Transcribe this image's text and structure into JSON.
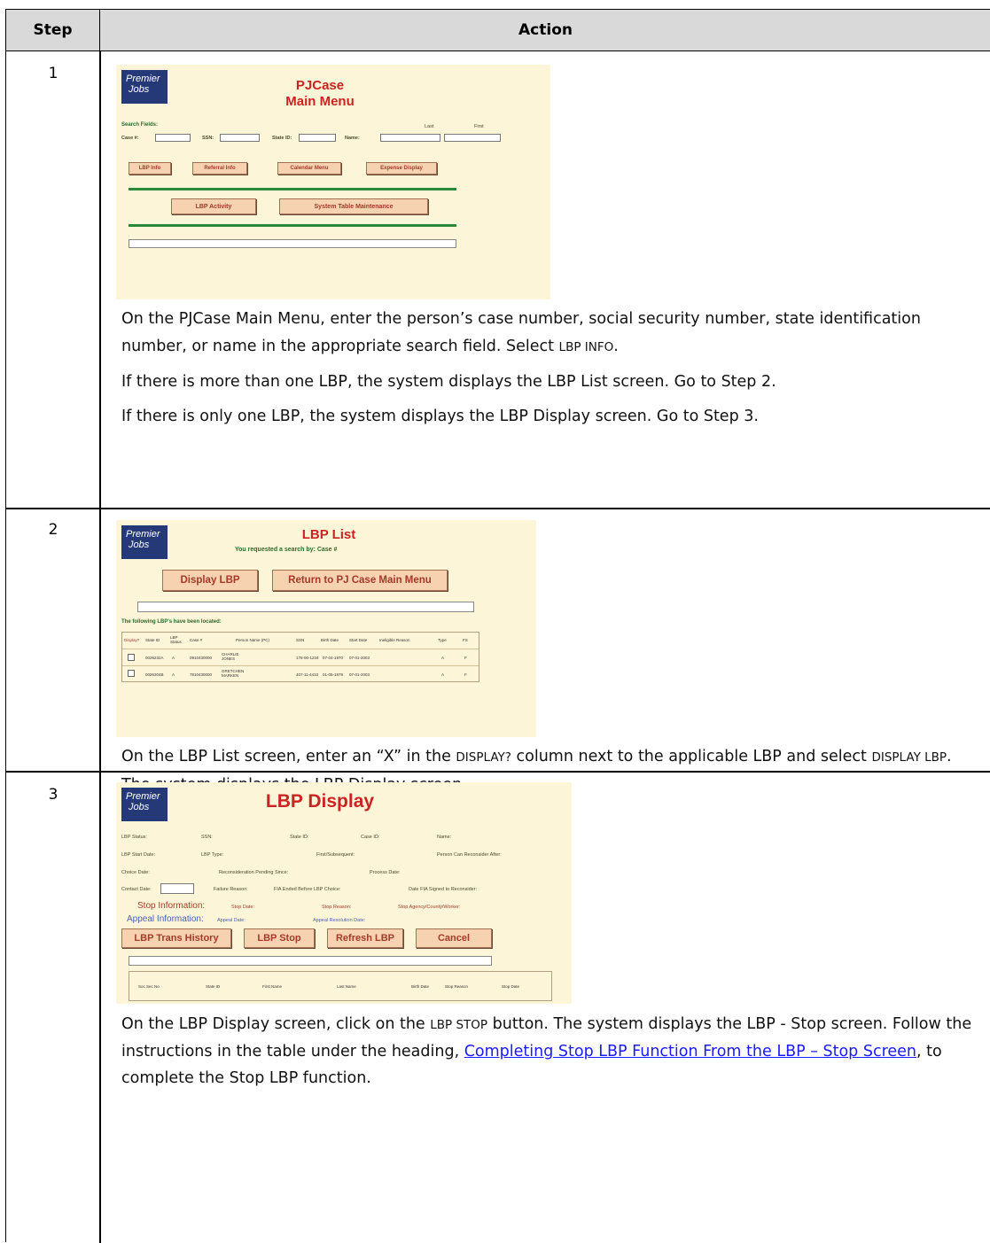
{
  "table": {
    "header": {
      "step": "Step",
      "action": "Action"
    },
    "rows": [
      {
        "step": "1",
        "screenshot": {
          "logo_line1": "Premier",
          "logo_line2": "Jobs",
          "title_line1": "PJCase",
          "title_line2": "Main Menu",
          "search_fields_label": "Search Fields:",
          "case_label": "Case #:",
          "ssn_label": "SSN:",
          "state_id_label": "State ID:",
          "name_label": "Name:",
          "last_label": "Last",
          "first_label": "First",
          "buttons": [
            "LBP Info",
            "Referral Info",
            "Calendar Menu",
            "Expense Display"
          ],
          "buttons2": [
            "LBP Activity",
            "System Table Maintenance"
          ]
        },
        "text": {
          "p1_a": "On the PJCase Main Menu, enter the person’s case number, social security number, state identification number, or name in the appropriate search field. Select ",
          "p1_sc": "LBP INFO",
          "p1_b": ".",
          "p2": "If there is more than one LBP, the system displays the LBP List screen. Go to Step 2.",
          "p3": "If there is only one LBP, the system displays the LBP Display screen. Go to Step 3."
        }
      },
      {
        "step": "2",
        "screenshot": {
          "logo_line1": "Premier",
          "logo_line2": "Jobs",
          "title": "LBP List",
          "subtitle": "You requested a search by: Case #",
          "btn_display": "Display LBP",
          "btn_return": "Return to PJ Case Main Menu",
          "located_label": "The following LBP's have been located:",
          "columns": [
            "Display?",
            "State ID",
            "LBP Status",
            "Case #",
            "Person Name (PC)",
            "SSN",
            "Birth Date",
            "Start Date",
            "Ineligible Reason",
            "Type",
            "FS"
          ],
          "rows": [
            [
              "",
              "0026232A",
              "A",
              "0910430000",
              "CHARLIE JONES",
              "178-00-1234",
              "07-04-1970",
              "07-01-2003",
              "",
              "A",
              "F"
            ],
            [
              "",
              "0026304B",
              "A",
              "7810430000",
              "GRETCHEN MARKEN",
              "407-11-4410",
              "01-05-1979",
              "07-01-2003",
              "",
              "A",
              "F"
            ]
          ]
        },
        "text": {
          "p1_a": "On the LBP List screen, enter an “X” in the ",
          "p1_sc1": "DISPLAY?",
          "p1_b": " column next to the applicable LBP and select ",
          "p1_sc2": "DISPLAY LBP",
          "p1_c": ". The system displays the LBP Display screen."
        }
      },
      {
        "step": "3",
        "screenshot": {
          "logo_line1": "Premier",
          "logo_line2": "Jobs",
          "title": "LBP Display",
          "row1": [
            "LBP Status:",
            "SSN:",
            "State ID:",
            "Case ID:",
            "Name:"
          ],
          "row2": [
            "LBP Start Date:",
            "LBP Type:",
            "First/Subsequent:",
            "Person Can Reconsider After:"
          ],
          "row3": [
            "Choice Date:",
            "Reconsideration Pending Since:",
            "Process Date:"
          ],
          "row4": [
            "Contact Date:",
            "Failure Reason:",
            "FIA Ended Before LBP Choice:",
            "Date FIA Signed to Reconsider:"
          ],
          "stop_info_label": "Stop Information:",
          "stop_fields": [
            "Stop Date:",
            "Stop Reason:",
            "Stop Agency/County/Worker:"
          ],
          "appeal_info_label": "Appeal Information:",
          "appeal_fields": [
            "Appeal Date:",
            "Appeal Resolution Date:"
          ],
          "buttons": [
            "LBP Trans History",
            "LBP Stop",
            "Refresh LBP",
            "Cancel"
          ],
          "columns": [
            "Soc Sec No",
            "State ID",
            "First Name",
            "Last Name",
            "Birth Date",
            "Stop Reason",
            "Stop Date"
          ]
        },
        "text": {
          "p1_a": "On the LBP Display screen, click on the ",
          "p1_sc": "LBP STOP",
          "p1_b": " button. The system displays the LBP - Stop screen. Follow the instructions in the table under the heading, ",
          "p1_link": "Completing Stop LBP Function From the LBP – Stop Screen",
          "p1_c": ", to complete the Stop LBP function."
        }
      }
    ]
  }
}
